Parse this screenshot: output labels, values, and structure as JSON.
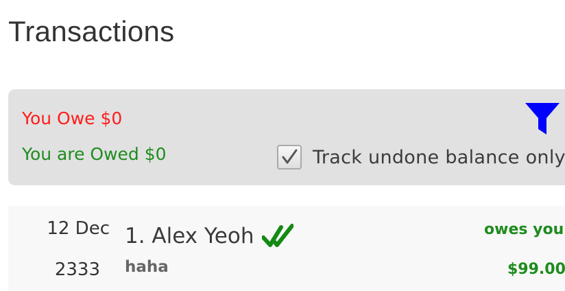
{
  "page": {
    "title": "Transactions"
  },
  "summary": {
    "owe_text": "You Owe $0",
    "owed_text": "You are Owed $0",
    "filter_icon": "filter-funnel-icon",
    "track_undone": {
      "label": "Track undone balance only",
      "checked": true
    }
  },
  "transactions": [
    {
      "date": "12 Dec",
      "year": "2333",
      "name": "1. Alex Yeoh",
      "status_icon": "double-check-icon",
      "note": "haha",
      "direction": "owes you",
      "amount": "$99.00"
    }
  ],
  "colors": {
    "owe_red": "#ff1c1c",
    "owed_green": "#1e8c1e",
    "filter_blue": "#0000ff",
    "panel_bg": "#e1e1e1",
    "row_bg": "#f8f8f8"
  }
}
